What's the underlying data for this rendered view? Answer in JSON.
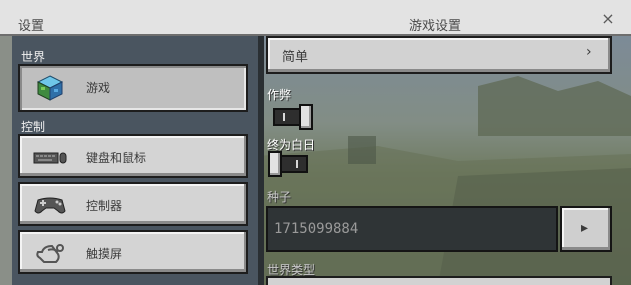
{
  "titlebar": {
    "left_title": "设置",
    "center_title": "游戏设置",
    "close_glyph": "×"
  },
  "sidebar": {
    "section_world": "世界",
    "section_controls": "控制",
    "items": [
      {
        "label": "游戏",
        "icon": "world-cube-icon",
        "selected": true
      },
      {
        "label": "键盘和鼠标",
        "icon": "keyboard-mouse-icon",
        "selected": false
      },
      {
        "label": "控制器",
        "icon": "gamepad-icon",
        "selected": false
      },
      {
        "label": "触摸屏",
        "icon": "touch-hand-icon",
        "selected": false
      }
    ]
  },
  "game_settings": {
    "difficulty_value": "简单",
    "chevron": "›",
    "cheats_label": "作弊",
    "cheats_on": true,
    "always_day_label": "终为白日",
    "always_day_on": false,
    "seed_label": "种子",
    "seed_value": "1715099884",
    "seed_button_chevron": "▸",
    "world_type_label": "世界类型"
  },
  "colors": {
    "panel_dark": "#4a5560",
    "button_light": "#d4d4d4",
    "titlebar": "#e3e3e3"
  }
}
